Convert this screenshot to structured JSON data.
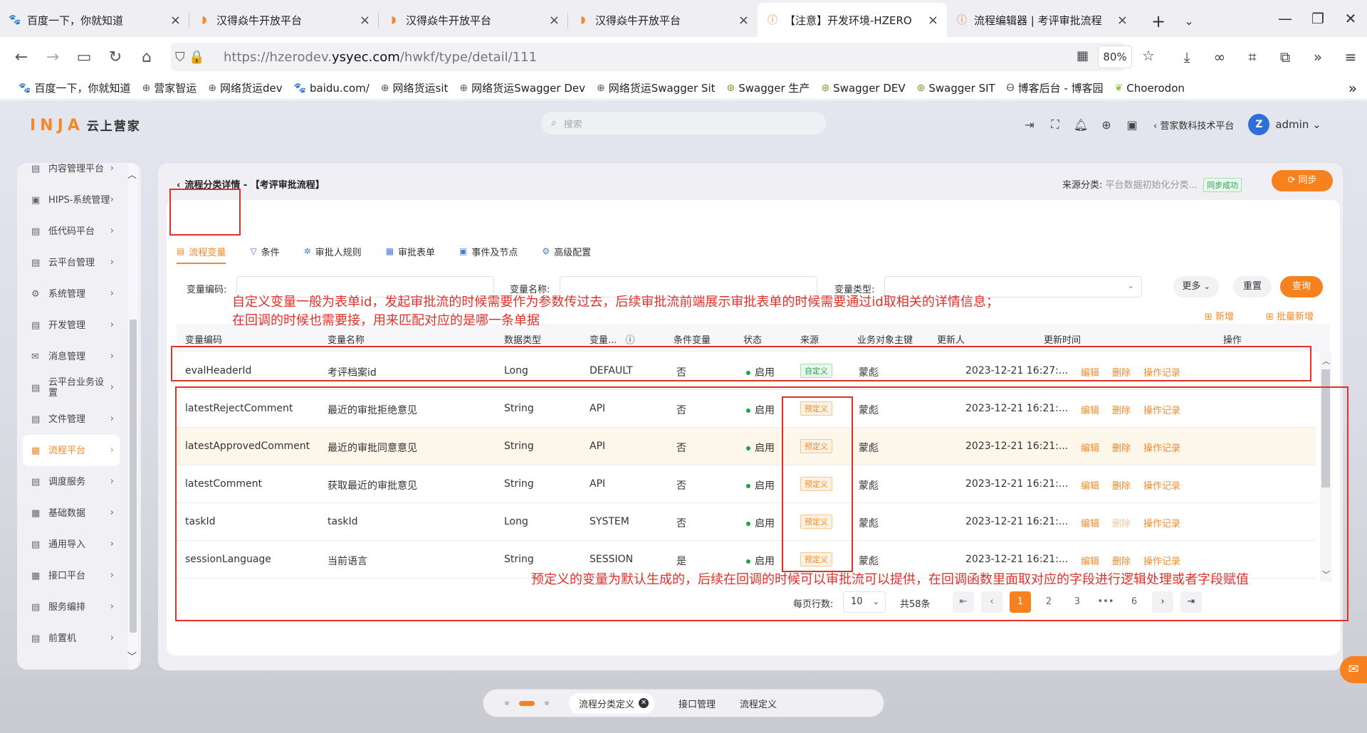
{
  "browser": {
    "tabs": [
      {
        "title": "百度一下，你就知道",
        "icon": "baidu-icon"
      },
      {
        "title": "汉得焱牛开放平台",
        "icon": "hand-icon"
      },
      {
        "title": "汉得焱牛开放平台",
        "icon": "hand-icon"
      },
      {
        "title": "汉得焱牛开放平台",
        "icon": "hand-icon"
      },
      {
        "title": "【注意】开发环境-HZERO",
        "icon": "warning-icon",
        "active": true
      },
      {
        "title": "流程编辑器 | 考评审批流程",
        "icon": "warning-icon"
      }
    ],
    "new_tab": "+",
    "url_host_pre": "https://hzerodev.",
    "url_host_main": "ysyec.com",
    "url_path": "/hwkf/type/detail/111",
    "zoom": "80%",
    "bookmarks": [
      "百度一下，你就知道",
      "营家智运",
      "网络货运dev",
      "baidu.com/",
      "网络货运sit",
      "网络货运Swagger Dev",
      "网络货运Swagger Sit",
      "Swagger 生产",
      "Swagger DEV",
      "Swagger SIT",
      "博客后台 - 博客园",
      "Choerodon"
    ]
  },
  "app": {
    "logo_main": "INJA",
    "logo_sub": "云上营家",
    "search_placeholder": "搜索",
    "platform": "‹ 营家数科技术平台",
    "avatar_letter": "Z",
    "user": "admin ⌄"
  },
  "sidebar": {
    "items": [
      {
        "label": "内容管理平台"
      },
      {
        "label": "HIPS-系统管理"
      },
      {
        "label": "低代码平台"
      },
      {
        "label": "云平台管理"
      },
      {
        "label": "系统管理"
      },
      {
        "label": "开发管理"
      },
      {
        "label": "消息管理"
      },
      {
        "label": "云平台业务设置"
      },
      {
        "label": "文件管理"
      },
      {
        "label": "流程平台",
        "active": true
      },
      {
        "label": "调度服务"
      },
      {
        "label": "基础数据"
      },
      {
        "label": "通用导入"
      },
      {
        "label": "接口平台"
      },
      {
        "label": "服务编排"
      },
      {
        "label": "前置机"
      }
    ]
  },
  "page": {
    "breadcrumb": "流程分类详情 - 【考评审批流程】",
    "source_label": "来源分类:",
    "source_value": "平台数据初始化分类...",
    "sync_badge": "同步成功",
    "sync_button": "同步",
    "tabs": [
      "流程变量",
      "条件",
      "审批人规则",
      "审批表单",
      "事件及节点",
      "高级配置"
    ],
    "form": {
      "code_label": "变量编码:",
      "name_label": "变量名称:",
      "type_label": "变量类型:",
      "more": "更多",
      "reset": "重置",
      "query": "查询"
    },
    "add": "新增",
    "batch_add": "批量新增",
    "columns": [
      "变量编码",
      "变量名称",
      "数据类型",
      "变量...",
      "条件变量",
      "状态",
      "来源",
      "业务对象主键",
      "更新人",
      "更新时间",
      "操作"
    ],
    "rows": [
      {
        "code": "evalHeaderId",
        "name": "考评档案id",
        "dtype": "Long",
        "vtype": "DEFAULT",
        "cond": "否",
        "status": "启用",
        "source": "自定义",
        "updater": "蒙彪",
        "time": "2023-12-21 16:27:..."
      },
      {
        "code": "latestRejectComment",
        "name": "最近的审批拒绝意见",
        "dtype": "String",
        "vtype": "API",
        "cond": "否",
        "status": "启用",
        "source": "预定义",
        "updater": "蒙彪",
        "time": "2023-12-21 16:21:..."
      },
      {
        "code": "latestApprovedComment",
        "name": "最近的审批同意意见",
        "dtype": "String",
        "vtype": "API",
        "cond": "否",
        "status": "启用",
        "source": "预定义",
        "updater": "蒙彪",
        "time": "2023-12-21 16:21:..."
      },
      {
        "code": "latestComment",
        "name": "获取最近的审批意见",
        "dtype": "String",
        "vtype": "API",
        "cond": "否",
        "status": "启用",
        "source": "预定义",
        "updater": "蒙彪",
        "time": "2023-12-21 16:21:..."
      },
      {
        "code": "taskId",
        "name": "taskId",
        "dtype": "Long",
        "vtype": "SYSTEM",
        "cond": "否",
        "status": "启用",
        "source": "预定义",
        "updater": "蒙彪",
        "time": "2023-12-21 16:21:..."
      },
      {
        "code": "sessionLanguage",
        "name": "当前语言",
        "dtype": "String",
        "vtype": "SESSION",
        "cond": "是",
        "status": "启用",
        "source": "预定义",
        "updater": "蒙彪",
        "time": "2023-12-21 16:21:..."
      }
    ],
    "ops": {
      "edit": "编辑",
      "delete": "删除",
      "log": "操作记录"
    },
    "pager": {
      "rows_label": "每页行数:",
      "size": "10",
      "total": "共58条",
      "pages": [
        "1",
        "2",
        "3",
        "•••",
        "6"
      ],
      "current": "1"
    }
  },
  "annotations": {
    "top_line1": "自定义变量一般为表单id，发起审批流的时候需要作为参数传过去，后续审批流前端展示审批表单的时候需要通过id取相关的详情信息；",
    "top_line2": "在回调的时候也需要接，用来匹配对应的是哪一条单据",
    "bottom": "预定义的变量为默认生成的，后续在回调的时候可以审批流可以提供，在回调函数里面取对应的字段进行逻辑处理或者字段赋值"
  },
  "bottom_bar": {
    "tabs": [
      "流程分类定义",
      "接口管理",
      "流程定义"
    ]
  },
  "colors": {
    "accent": "#f5821f",
    "annotation": "#e0302a",
    "success": "#22a04a"
  }
}
